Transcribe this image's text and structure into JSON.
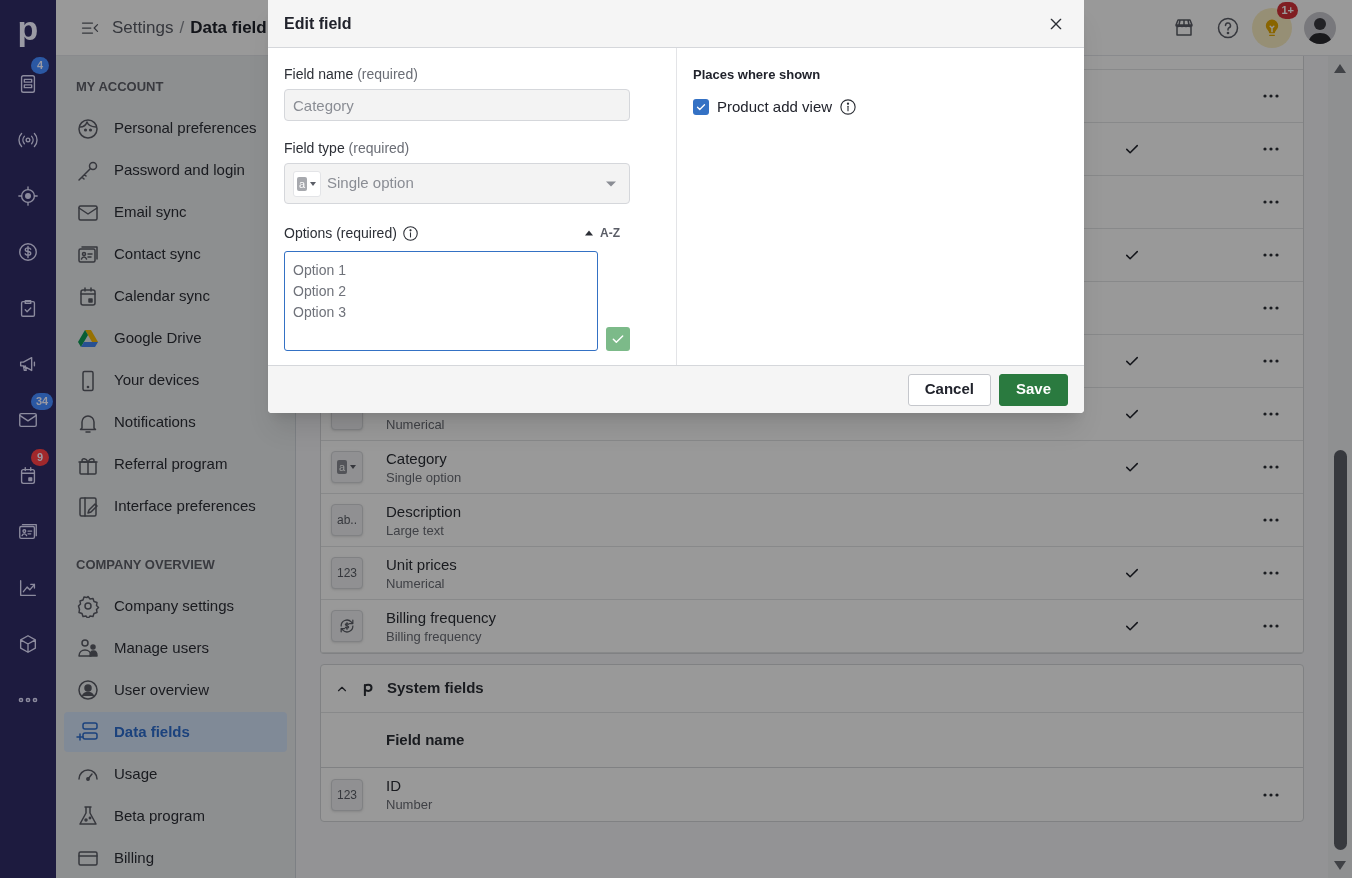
{
  "nav_rail": {
    "logo": "p",
    "items": [
      {
        "kind": "document",
        "badge": {
          "text": "4",
          "color": "#2b58a3"
        }
      },
      {
        "kind": "broadcast"
      },
      {
        "kind": "target"
      },
      {
        "kind": "dollar"
      },
      {
        "kind": "clipboard"
      },
      {
        "kind": "megaphone"
      },
      {
        "kind": "envelope",
        "badge": {
          "text": "34",
          "color": "#2b58a3"
        }
      },
      {
        "kind": "calendar",
        "badge": {
          "text": "9",
          "color": "#a0282c"
        }
      },
      {
        "kind": "contact"
      },
      {
        "kind": "chart"
      },
      {
        "kind": "box"
      },
      {
        "kind": "more"
      }
    ]
  },
  "header": {
    "breadcrumb_parent": "Settings",
    "separator": "/",
    "breadcrumb_current": "Data field",
    "tips_badge": "1+"
  },
  "sidebar": {
    "sections": [
      {
        "title": "MY ACCOUNT",
        "items": [
          {
            "label": "Personal preferences",
            "kind": "face",
            "selected": false
          },
          {
            "label": "Password and login",
            "kind": "key",
            "selected": false
          },
          {
            "label": "Email sync",
            "kind": "envelope",
            "selected": false
          },
          {
            "label": "Contact sync",
            "kind": "contact",
            "selected": false
          },
          {
            "label": "Calendar sync",
            "kind": "calendar",
            "selected": false
          },
          {
            "label": "Google Drive",
            "kind": "drive",
            "selected": false
          },
          {
            "label": "Your devices",
            "kind": "phone",
            "selected": false
          },
          {
            "label": "Notifications",
            "kind": "bell",
            "selected": false
          },
          {
            "label": "Referral program",
            "kind": "gift",
            "selected": false
          },
          {
            "label": "Interface preferences",
            "kind": "panel",
            "selected": false
          }
        ]
      },
      {
        "title": "COMPANY OVERVIEW",
        "items": [
          {
            "label": "Company settings",
            "kind": "gear",
            "selected": false
          },
          {
            "label": "Manage users",
            "kind": "users",
            "selected": false
          },
          {
            "label": "User overview",
            "kind": "user",
            "selected": false
          },
          {
            "label": "Data fields",
            "kind": "fields",
            "selected": true
          },
          {
            "label": "Usage",
            "kind": "gauge",
            "selected": false
          },
          {
            "label": "Beta program",
            "kind": "flask",
            "selected": false
          },
          {
            "label": "Billing",
            "kind": "card",
            "selected": false
          }
        ]
      }
    ]
  },
  "custom_fields": {
    "rows": [
      {
        "checked": false
      },
      {
        "checked": true
      },
      {
        "checked": false
      },
      {
        "checked": true
      },
      {
        "checked": false
      },
      {
        "checked": true
      },
      {
        "kind": "numeric",
        "subtitle": "Numerical",
        "checked": true
      },
      {
        "kind": "option",
        "icon_label": "a",
        "name": "Category",
        "subtitle": "Single option",
        "checked": true
      },
      {
        "kind": "text",
        "icon_label": "ab..",
        "name": "Description",
        "subtitle": "Large text",
        "checked": false
      },
      {
        "kind": "numeric",
        "icon_label": "123",
        "name": "Unit prices",
        "subtitle": "Numerical",
        "checked": true
      },
      {
        "kind": "billing",
        "name": "Billing frequency",
        "subtitle": "Billing frequency",
        "checked": true
      }
    ]
  },
  "system_fields": {
    "title": "System fields",
    "expanded": true,
    "column": "Field name",
    "rows": [
      {
        "kind": "numeric",
        "icon_label": "123",
        "name": "ID",
        "subtitle": "Number"
      }
    ]
  },
  "modal": {
    "title": "Edit field",
    "field_name": {
      "label": "Field name",
      "hint": "(required)",
      "value": "Category",
      "disabled": true
    },
    "field_type": {
      "label": "Field type",
      "hint": "(required)",
      "icon_label": "a",
      "value": "Single option",
      "disabled": true
    },
    "options": {
      "label": "Options (required)",
      "sort_label": "A-Z",
      "placeholder": "Option 1\nOption 2\nOption 3",
      "focused": true
    },
    "places": {
      "title": "Places where shown",
      "items": [
        {
          "label": "Product add view",
          "checked": true
        }
      ]
    },
    "buttons": [
      {
        "kind": "secondary",
        "label": "Cancel"
      },
      {
        "kind": "primary",
        "label": "Save"
      }
    ]
  }
}
